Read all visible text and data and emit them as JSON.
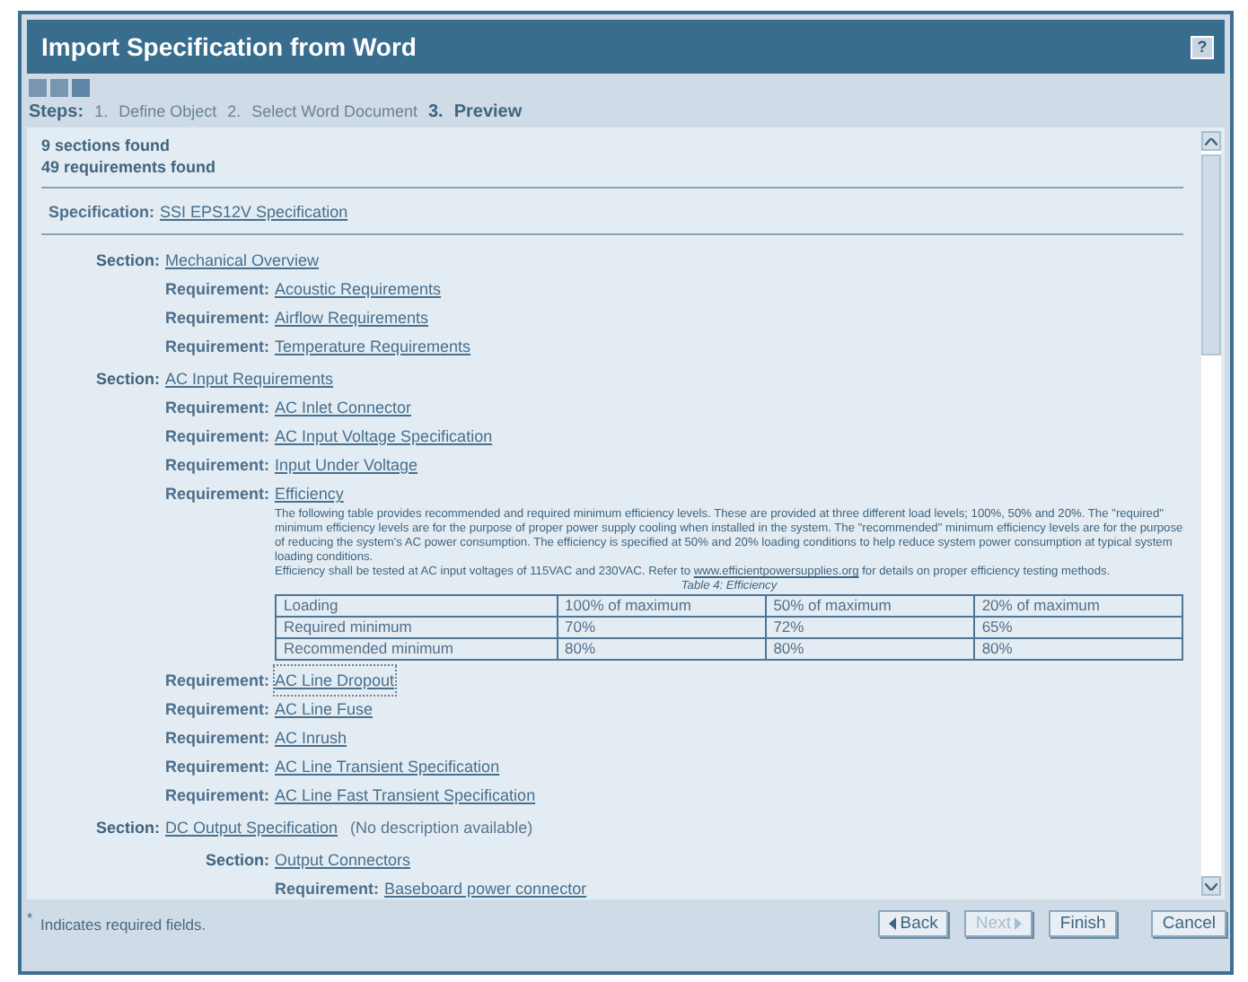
{
  "window": {
    "title": "Import Specification from Word",
    "help": "?"
  },
  "steps": {
    "label": "Steps:",
    "items": [
      {
        "number": "1.",
        "label": "Define Object",
        "selected": false
      },
      {
        "number": "2.",
        "label": "Select Word Document",
        "selected": false
      },
      {
        "number": "3.",
        "label": "Preview",
        "selected": true
      }
    ]
  },
  "summary": [
    "9 sections found",
    "49 requirements found"
  ],
  "specification": {
    "label": "Specification:",
    "name": "SSI EPS12V Specification"
  },
  "tree": [
    {
      "kind": "section",
      "label": "Section:",
      "name": "Mechanical Overview",
      "focused": false,
      "children": [
        {
          "kind": "requirement",
          "label": "Requirement:",
          "name": "Acoustic Requirements",
          "focused": false
        },
        {
          "kind": "requirement",
          "label": "Requirement:",
          "name": "Airflow Requirements",
          "focused": false
        },
        {
          "kind": "requirement",
          "label": "Requirement:",
          "name": "Temperature Requirements",
          "focused": false
        }
      ]
    },
    {
      "kind": "section",
      "label": "Section:",
      "name": "AC Input Requirements",
      "focused": false,
      "children": [
        {
          "kind": "requirement",
          "label": "Requirement:",
          "name": "AC Inlet Connector",
          "focused": false
        },
        {
          "kind": "requirement",
          "label": "Requirement:",
          "name": "AC Input Voltage Specification",
          "focused": false
        },
        {
          "kind": "requirement",
          "label": "Requirement:",
          "name": "Input Under Voltage",
          "focused": false
        },
        {
          "kind": "requirement",
          "label": "Requirement:",
          "name": "Efficiency",
          "focused": false,
          "description": {
            "paragraph": "The following table provides recommended and required minimum efficiency levels. These are provided at three different load levels; 100%, 50% and 20%. The \"required\" minimum efficiency levels are for the purpose of proper power supply cooling when installed in the system. The \"recommended\" minimum efficiency levels are for the purpose of reducing the system's AC power consumption. The efficiency is specified at 50% and 20% loading conditions to help reduce system power consumption at typical system loading conditions.",
            "before": "Efficiency shall be tested at AC input voltages of 115VAC and 230VAC. Refer to",
            "link": "www.efficientpowersupplies.org",
            "after": "for details on proper efficiency testing methods.",
            "caption": "Table 4: Efficiency",
            "rows": [
              [
                "Loading",
                "100% of maximum",
                "50% of maximum",
                "20% of maximum"
              ],
              [
                "Required minimum",
                "70%",
                "72%",
                "65%"
              ],
              [
                "Recommended minimum",
                "80%",
                "80%",
                "80%"
              ]
            ]
          }
        },
        {
          "kind": "requirement",
          "label": "Requirement:",
          "name": "AC Line Dropout",
          "focused": true
        },
        {
          "kind": "requirement",
          "label": "Requirement:",
          "name": "AC Line Fuse",
          "focused": false
        },
        {
          "kind": "requirement",
          "label": "Requirement:",
          "name": "AC Inrush",
          "focused": false
        },
        {
          "kind": "requirement",
          "label": "Requirement:",
          "name": "AC Line Transient Specification",
          "focused": false
        },
        {
          "kind": "requirement",
          "label": "Requirement:",
          "name": "AC Line Fast Transient Specification",
          "focused": false
        }
      ]
    },
    {
      "kind": "section",
      "label": "Section:",
      "name": "DC Output Specification",
      "note": "(No description available)",
      "focused": false,
      "children": [
        {
          "kind": "section",
          "label": "Section:",
          "name": "Output Connectors",
          "focused": false,
          "children": [
            {
              "kind": "requirement",
              "label": "Requirement:",
              "name": "Baseboard power connector",
              "focused": false
            }
          ]
        }
      ]
    }
  ],
  "footer": {
    "mark": "*",
    "note": "Indicates required fields.",
    "buttons": [
      {
        "kind": "back",
        "label": "Back",
        "disabled": false
      },
      {
        "kind": "next",
        "label": "Next",
        "disabled": true
      },
      {
        "kind": "finish",
        "label": "Finish",
        "disabled": false
      },
      {
        "kind": "cancel",
        "label": "Cancel",
        "disabled": false
      }
    ]
  }
}
